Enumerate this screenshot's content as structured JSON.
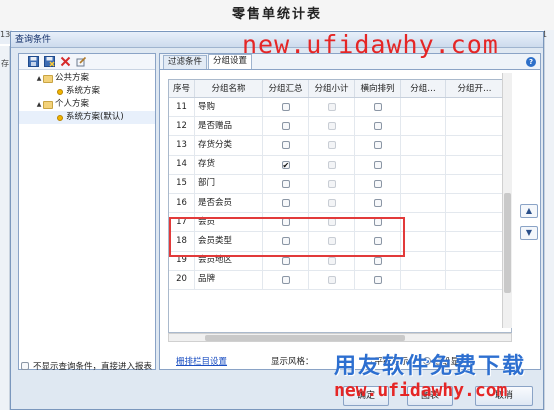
{
  "report_title": "零售单统计表",
  "background": {
    "left_number": "13",
    "left_column_label": "存",
    "right_number": "1"
  },
  "dialog": {
    "title": "查询条件"
  },
  "tree": {
    "nodes": [
      {
        "label": "公共方案",
        "expander": "▲",
        "kind": "folder",
        "level": 1
      },
      {
        "label": "系统方案",
        "expander": "",
        "kind": "item",
        "level": 2
      },
      {
        "label": "个人方案",
        "expander": "▲",
        "kind": "folder",
        "level": 1
      },
      {
        "label": "系统方案(默认)",
        "expander": "",
        "kind": "item",
        "level": 2,
        "selected": true
      }
    ]
  },
  "tabs": [
    {
      "label": "过滤条件",
      "active": false
    },
    {
      "label": "分组设置",
      "active": true
    }
  ],
  "grid": {
    "headers": [
      "序号",
      "分组名称",
      "分组汇总",
      "分组小计",
      "横向排列",
      "分组…",
      "分组开…"
    ],
    "rows": [
      {
        "no": "11",
        "name": "导购",
        "a": false,
        "b": false,
        "c": false
      },
      {
        "no": "12",
        "name": "是否赠品",
        "a": false,
        "b": false,
        "c": false
      },
      {
        "no": "13",
        "name": "存货分类",
        "a": false,
        "b": false,
        "c": false
      },
      {
        "no": "14",
        "name": "存货",
        "a": true,
        "b": false,
        "c": false
      },
      {
        "no": "15",
        "name": "部门",
        "a": false,
        "b": false,
        "c": false
      },
      {
        "no": "16",
        "name": "是否会员",
        "a": false,
        "b": false,
        "c": false
      },
      {
        "no": "17",
        "name": "会员",
        "a": false,
        "b": false,
        "c": false
      },
      {
        "no": "18",
        "name": "会员类型",
        "a": false,
        "b": false,
        "c": false
      },
      {
        "no": "19",
        "name": "会员地区",
        "a": false,
        "b": false,
        "c": false
      },
      {
        "no": "20",
        "name": "品牌",
        "a": false,
        "b": false,
        "c": false
      }
    ]
  },
  "footer": {
    "link": "栅排栏目设置",
    "style_label": "显示风格：",
    "radio_flat": "平级显示",
    "radio_level": "层级显示",
    "selected": "层级显示"
  },
  "bottom": {
    "skip_checkbox": "不显示查询条件，直接进入报表",
    "ok": "确定",
    "ok_hint": "(O)",
    "middle": "图表",
    "cancel": "取消"
  },
  "watermarks": {
    "top_url": "new.ufidawhy.com",
    "bottom_cn": "用友软件免费下载",
    "bottom_url": "new.ufidawhy.com"
  },
  "colors": {
    "red_highlight": "#e23a3a",
    "link": "#1a4ec2",
    "watermark_blue": "#2d6fd0"
  }
}
